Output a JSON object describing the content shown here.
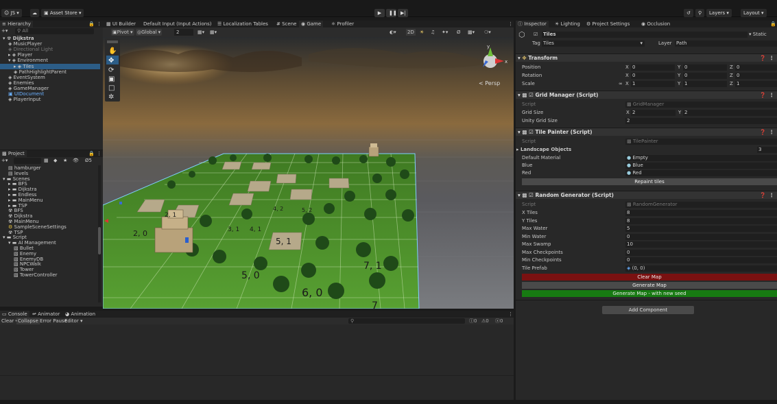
{
  "toolbar": {
    "account": "JS",
    "asset_store": "Asset Store",
    "layers": "Layers",
    "layout": "Layout"
  },
  "tabs_scene": [
    "UI Builder",
    "Default Input (Input Actions)",
    "Localization Tables",
    "Scene",
    "Game",
    "Profiler"
  ],
  "scene_toolbar": {
    "pivot": "Pivot",
    "global": "Global",
    "grid_num": "2",
    "mode_2d": "2D",
    "persp": "< Persp"
  },
  "hierarchy": {
    "title": "Hierarchy",
    "search": "All",
    "items": [
      {
        "label": "Dijkstra",
        "indent": 0
      },
      {
        "label": "MusicPlayer",
        "indent": 1
      },
      {
        "label": "Directional Light",
        "indent": 1
      },
      {
        "label": "Player",
        "indent": 1
      },
      {
        "label": "Environment",
        "indent": 1
      },
      {
        "label": "Tiles",
        "indent": 2
      },
      {
        "label": "PathHighlightParent",
        "indent": 2
      },
      {
        "label": "EventSystem",
        "indent": 1
      },
      {
        "label": "Enemies",
        "indent": 1
      },
      {
        "label": "GameManager",
        "indent": 1
      },
      {
        "label": "UIDocument",
        "indent": 1
      },
      {
        "label": "PlayerInput",
        "indent": 1
      }
    ]
  },
  "project": {
    "title": "Project",
    "badge": "5",
    "items": [
      {
        "label": "hamburger",
        "indent": 1
      },
      {
        "label": "levels",
        "indent": 1
      },
      {
        "label": "Scenes",
        "indent": 0
      },
      {
        "label": "BFS",
        "indent": 1
      },
      {
        "label": "Dijkstra",
        "indent": 1
      },
      {
        "label": "Endless",
        "indent": 1
      },
      {
        "label": "MainMenu",
        "indent": 1
      },
      {
        "label": "TSP",
        "indent": 1
      },
      {
        "label": "BFS",
        "indent": 1
      },
      {
        "label": "Dijkstra",
        "indent": 1
      },
      {
        "label": "MainMenu",
        "indent": 1
      },
      {
        "label": "SampleSceneSettings",
        "indent": 1
      },
      {
        "label": "TSP",
        "indent": 1
      },
      {
        "label": "Script",
        "indent": 0
      },
      {
        "label": "AI Management",
        "indent": 1
      },
      {
        "label": "Bullet",
        "indent": 2
      },
      {
        "label": "Enemy",
        "indent": 2
      },
      {
        "label": "EnemyDB",
        "indent": 2
      },
      {
        "label": "NPCWalk",
        "indent": 2
      },
      {
        "label": "Tower",
        "indent": 2
      },
      {
        "label": "TowerController",
        "indent": 2
      }
    ]
  },
  "console": {
    "tabs": [
      "Console",
      "Animator",
      "Animation"
    ],
    "tools": [
      "Clear",
      "Collapse",
      "Error Pause",
      "Editor"
    ],
    "counts": [
      "0",
      "0",
      "0"
    ]
  },
  "inspector": {
    "tabs": [
      "Inspector",
      "Lighting",
      "Project Settings",
      "Occlusion"
    ],
    "object_name": "Tiles",
    "static_label": "Static",
    "tag_label": "Tag",
    "tag_value": "Tiles",
    "layer_label": "Layer",
    "layer_value": "Path",
    "transform": {
      "title": "Transform",
      "position_label": "Position",
      "position": [
        "0",
        "0",
        "0"
      ],
      "rotation_label": "Rotation",
      "rotation": [
        "0",
        "0",
        "0"
      ],
      "scale_label": "Scale",
      "scale": [
        "1",
        "1",
        "1"
      ]
    },
    "grid_manager": {
      "title": "Grid Manager (Script)",
      "script_label": "Script",
      "script": "GridManager",
      "grid_size_label": "Grid Size",
      "grid_size": [
        "2",
        "2"
      ],
      "unity_grid_label": "Unity Grid Size",
      "unity_grid": "2"
    },
    "tile_painter": {
      "title": "Tile Painter (Script)",
      "script_label": "Script",
      "script": "TilePainter",
      "landscape_label": "Landscape Objects",
      "landscape_count": "3",
      "default_label": "Default Material",
      "default_value": "Empty",
      "blue_label": "Blue",
      "blue_value": "Blue",
      "red_label": "Red",
      "red_value": "Red",
      "repaint": "Repaint tiles"
    },
    "random_generator": {
      "title": "Random Generator (Script)",
      "script_label": "Script",
      "script": "RandomGenerator",
      "fields": [
        {
          "label": "X Tiles",
          "value": "8"
        },
        {
          "label": "Y Tiles",
          "value": "8"
        },
        {
          "label": "Max Water",
          "value": "5"
        },
        {
          "label": "Min Water",
          "value": "0"
        },
        {
          "label": "Max Swamp",
          "value": "10"
        },
        {
          "label": "Max Checkpoints",
          "value": "0"
        },
        {
          "label": "Min Checkpoints",
          "value": "0"
        },
        {
          "label": "Tile Prefab",
          "value": "(0, 0)"
        }
      ],
      "clear": "Clear Map",
      "generate": "Generate Map",
      "generate_seed": "Generate Map - with new seed"
    },
    "add_component": "Add Component"
  },
  "tile_labels": [
    "5, 0",
    "6, 0",
    "7, 1",
    "5, 1",
    "4, 2",
    "4, 1",
    "3, 1",
    "2, 0",
    "2, 1",
    "5, 2",
    "7"
  ],
  "colors": {
    "accent_blue": "#2c5d87",
    "clear_red": "#7a1111",
    "seed_green": "#177a12",
    "grass": "#4f8e2a"
  }
}
